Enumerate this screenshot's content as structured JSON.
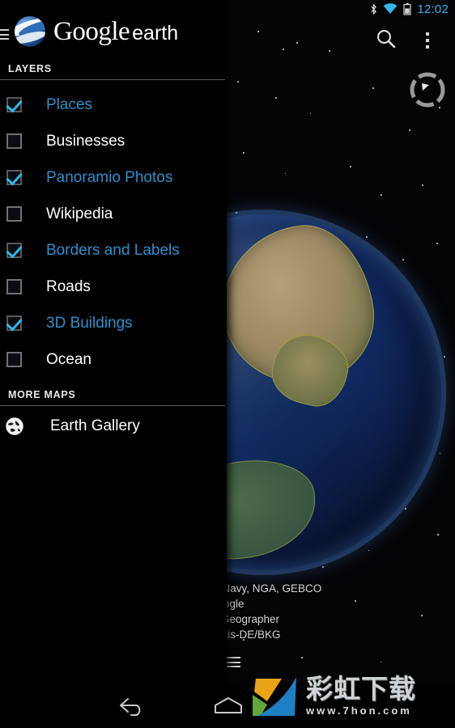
{
  "status_bar": {
    "bluetooth_icon": "bluetooth-icon",
    "wifi_icon": "wifi-icon",
    "battery_icon": "battery-icon",
    "clock": "12:02",
    "accent_color": "#33b5e5"
  },
  "app": {
    "logo_mark": "google-earth-globe-icon",
    "name_primary": "Google",
    "name_secondary": "earth",
    "menu_icon": "hamburger-icon"
  },
  "action_bar": {
    "search_icon": "search-icon",
    "overflow_icon": "overflow-menu-icon",
    "compass_icon": "compass-icon"
  },
  "drawer": {
    "layers_header": "LAYERS",
    "more_maps_header": "MORE MAPS",
    "checked_color": "#2a8fcd",
    "unchecked_color": "#ffffff",
    "layers": [
      {
        "label": "Places",
        "checked": true
      },
      {
        "label": "Businesses",
        "checked": false
      },
      {
        "label": "Panoramio Photos",
        "checked": true
      },
      {
        "label": "Wikipedia",
        "checked": false
      },
      {
        "label": "Borders and Labels",
        "checked": true
      },
      {
        "label": "Roads",
        "checked": false
      },
      {
        "label": "3D Buildings",
        "checked": true
      },
      {
        "label": "Ocean",
        "checked": false
      }
    ],
    "more_maps": [
      {
        "label": "Earth Gallery",
        "icon": "globe-icon"
      }
    ]
  },
  "map": {
    "attribution_lines": [
      "S. Navy, NGA, GEBCO",
      "Google",
      "te Geographer",
      "Basis-DE/BKG"
    ],
    "legend_icon": "legend-hamburger-icon"
  },
  "nav_bar": {
    "back_icon": "back-arrow-icon",
    "home_icon": "home-icon"
  },
  "watermark": {
    "logo_icon": "rainbow-download-logo-icon",
    "title": "彩虹下载",
    "url": "www.7hon.com",
    "colors": {
      "orange": "#e8a317",
      "green": "#63a83a",
      "blue": "#1f7fc4"
    }
  }
}
